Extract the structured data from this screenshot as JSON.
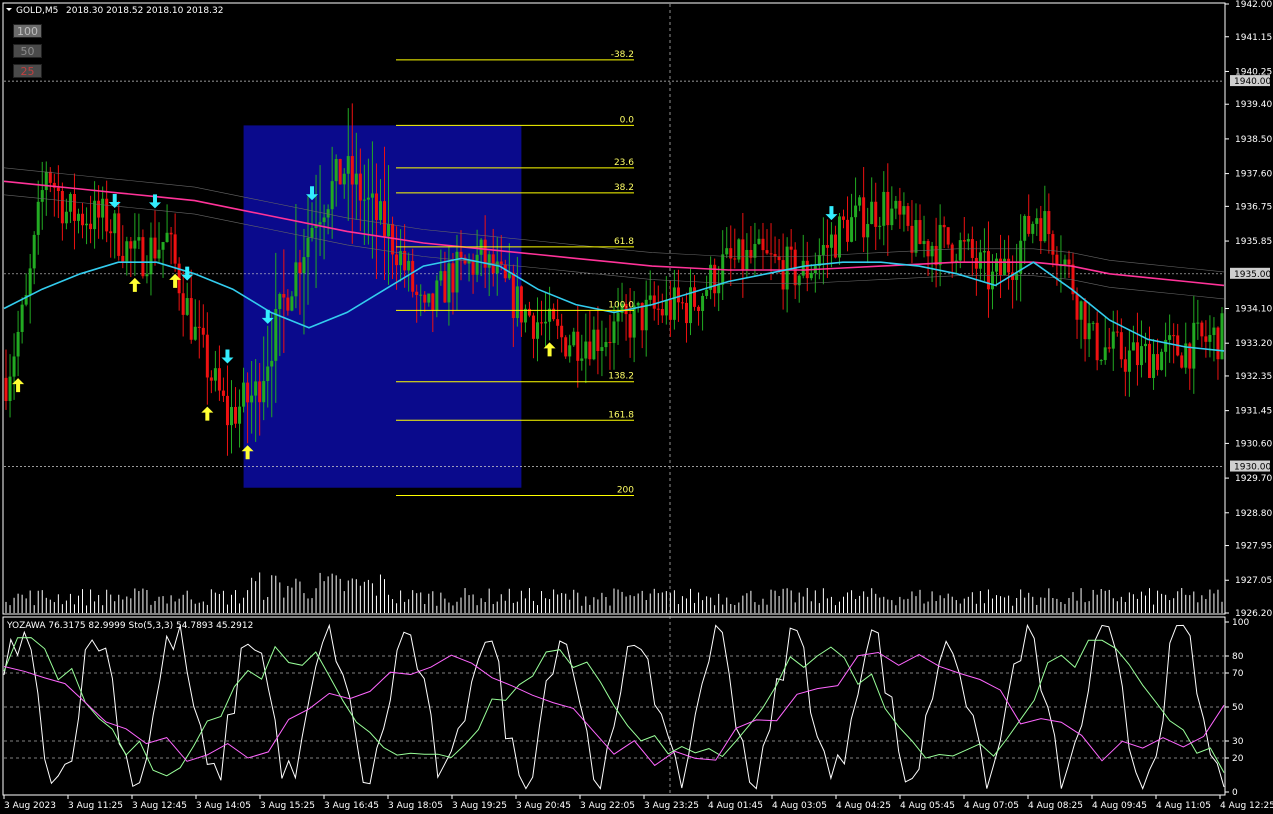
{
  "header": {
    "symbol_label": "GOLD,M5",
    "ohlc_label": "2018.30 2018.52 2018.10 2018.32"
  },
  "buttons": [
    {
      "label": "100",
      "bg": "#6b6b6b",
      "color": "#bdbdbd"
    },
    {
      "label": "50",
      "bg": "#4a4a4a",
      "color": "#8c8c8c"
    },
    {
      "label": "25",
      "bg": "#4a4a4a",
      "color": "#c04040"
    }
  ],
  "oscillator": {
    "label": "YOZAWA 76.3175 82.9999  Sto(5,3,3) 54.7893 45.2912",
    "levels": [
      "100",
      "80",
      "70",
      "50",
      "30",
      "20",
      "0"
    ]
  },
  "colors": {
    "bull": "#22aa22",
    "bear": "#ee1111",
    "ma_slow": "#ff3399",
    "ma_fast": "#33ccee",
    "fib": "#ffff00",
    "box": "#0a0a8c",
    "arrow_up": "#ffff33",
    "arrow_down": "#33eeff",
    "stoch_main": "#ffffff",
    "stoch_k": "#99ff99",
    "stoch_d": "#ff66ff"
  },
  "chart_data": {
    "type": "candlestick",
    "symbol": "GOLD",
    "timeframe": "M5",
    "price_axis": {
      "ticks": [
        "1942.00",
        "1941.15",
        "1940.25",
        "1939.40",
        "1938.50",
        "1937.60",
        "1936.75",
        "1935.85",
        "1934.10",
        "1933.20",
        "1932.35",
        "1931.45",
        "1930.60",
        "1929.70",
        "1928.80",
        "1927.95",
        "1927.05",
        "1926.20"
      ],
      "highlighted": [
        "1940.00",
        "1935.00",
        "1930.00"
      ],
      "range": [
        1926.2,
        1942.0
      ]
    },
    "time_axis": {
      "labels": [
        "3 Aug 2023",
        "3 Aug 11:25",
        "3 Aug 12:45",
        "3 Aug 14:05",
        "3 Aug 15:25",
        "3 Aug 16:45",
        "3 Aug 18:05",
        "3 Aug 19:25",
        "3 Aug 20:45",
        "3 Aug 22:05",
        "3 Aug 23:25",
        "4 Aug 01:45",
        "4 Aug 03:05",
        "4 Aug 04:25",
        "4 Aug 05:45",
        "4 Aug 07:05",
        "4 Aug 08:25",
        "4 Aug 09:45",
        "4 Aug 11:05",
        "4 Aug 12:25"
      ]
    },
    "fibonacci": [
      {
        "level": "-38.2",
        "price": 1940.55
      },
      {
        "level": "0.0",
        "price": 1938.85
      },
      {
        "level": "23.6",
        "price": 1937.75
      },
      {
        "level": "38.2",
        "price": 1937.1
      },
      {
        "level": "61.8",
        "price": 1935.7
      },
      {
        "level": "100.0",
        "price": 1934.05
      },
      {
        "level": "138.2",
        "price": 1932.2
      },
      {
        "level": "161.8",
        "price": 1931.2
      },
      {
        "level": "200",
        "price": 1929.25
      }
    ],
    "box": {
      "from_price": 1938.85,
      "to_price": 1929.45
    },
    "ma_slow": [
      1937.4,
      1937.3,
      1937.2,
      1937.1,
      1937.0,
      1936.9,
      1936.7,
      1936.5,
      1936.3,
      1936.1,
      1935.95,
      1935.8,
      1935.7,
      1935.6,
      1935.5,
      1935.4,
      1935.3,
      1935.2,
      1935.15,
      1935.1,
      1935.1,
      1935.1,
      1935.15,
      1935.2,
      1935.25,
      1935.3,
      1935.3,
      1935.3,
      1935.2,
      1935.0,
      1934.9,
      1934.8,
      1934.7
    ],
    "ma_fast": [
      1934.1,
      1934.6,
      1935.0,
      1935.3,
      1935.3,
      1935.0,
      1934.6,
      1934.0,
      1933.6,
      1934.0,
      1934.6,
      1935.2,
      1935.4,
      1935.2,
      1934.6,
      1934.2,
      1934.0,
      1934.2,
      1934.5,
      1934.8,
      1935.0,
      1935.2,
      1935.3,
      1935.3,
      1935.2,
      1935.0,
      1934.7,
      1935.3,
      1934.6,
      1933.8,
      1933.3,
      1933.1,
      1933.0
    ],
    "signals": [
      {
        "type": "up",
        "candle": 3
      },
      {
        "type": "down",
        "candle": 27
      },
      {
        "type": "up",
        "candle": 32
      },
      {
        "type": "down",
        "candle": 37
      },
      {
        "type": "up",
        "candle": 42
      },
      {
        "type": "down",
        "candle": 45
      },
      {
        "type": "up",
        "candle": 50
      },
      {
        "type": "down",
        "candle": 55
      },
      {
        "type": "up",
        "candle": 60
      },
      {
        "type": "down",
        "candle": 65
      },
      {
        "type": "down",
        "candle": 76
      },
      {
        "type": "up",
        "candle": 135
      },
      {
        "type": "down",
        "candle": 205
      }
    ]
  }
}
